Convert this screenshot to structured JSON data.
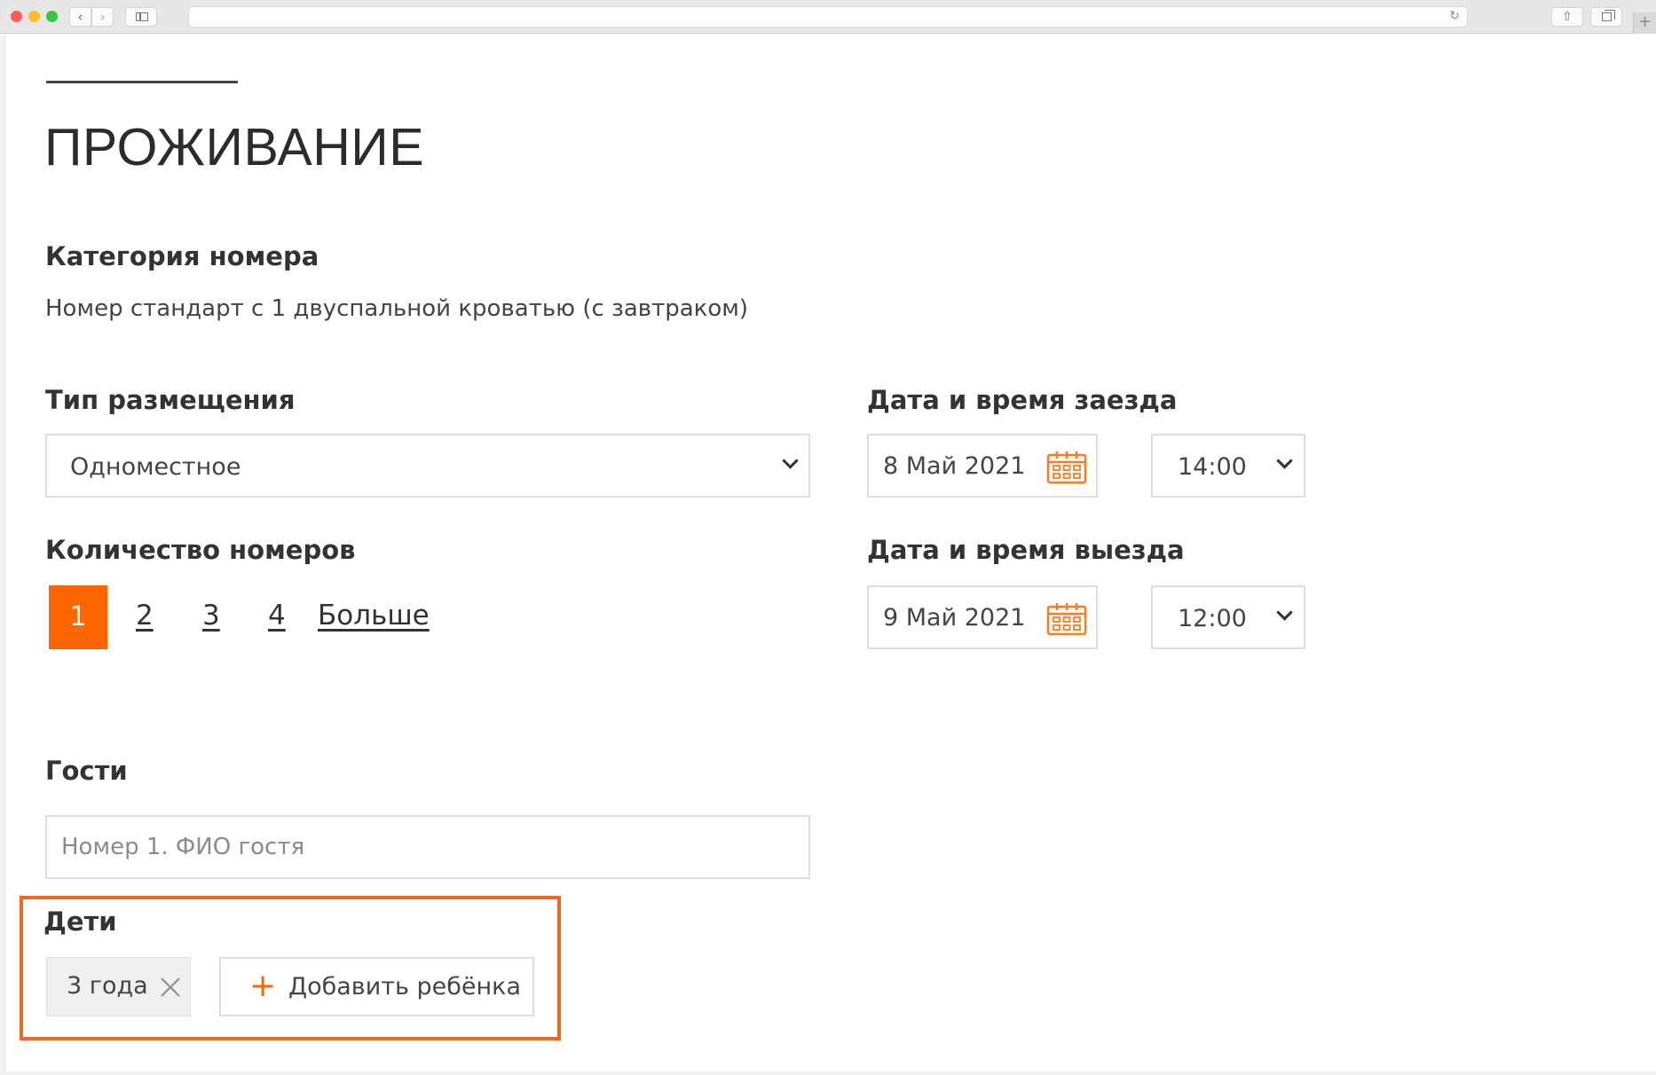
{
  "page": {
    "title": "ПРОЖИВАНИЕ"
  },
  "room_category": {
    "label": "Категория номера",
    "value": "Номер стандарт с 1 двуспальной кроватью (с завтраком)"
  },
  "accommodation": {
    "label": "Тип размещения",
    "selected": "Одноместное"
  },
  "checkin": {
    "label": "Дата и время заезда",
    "date": "8 Май 2021",
    "time": "14:00"
  },
  "checkout": {
    "label": "Дата и время выезда",
    "date": "9 Май 2021",
    "time": "12:00"
  },
  "rooms_count": {
    "label": "Количество номеров",
    "selected": "1",
    "options": [
      "2",
      "3",
      "4"
    ],
    "more": "Больше"
  },
  "guests": {
    "label": "Гости",
    "placeholder": "Номер 1. ФИО гостя"
  },
  "children": {
    "label": "Дети",
    "chip": "3 года",
    "add_label": "Добавить ребёнка"
  },
  "colors": {
    "accent": "#ff6600",
    "highlight_border": "#f26722"
  },
  "icons": {
    "calendar": "calendar-icon",
    "chevron": "chevron-down-icon",
    "close": "close-icon",
    "plus": "plus-icon"
  }
}
